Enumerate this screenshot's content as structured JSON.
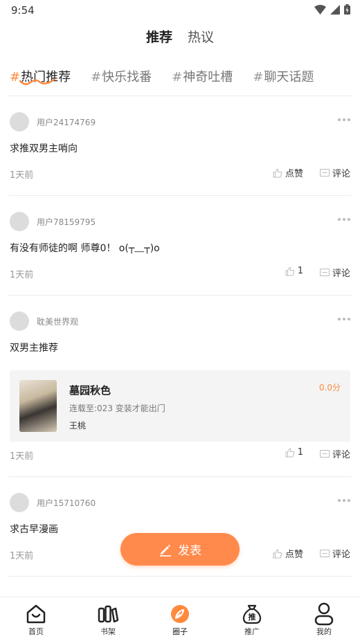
{
  "status_bar": {
    "time": "9:54"
  },
  "top_tabs": [
    {
      "label": "推荐",
      "active": true
    },
    {
      "label": "热议",
      "active": false
    }
  ],
  "topic_tabs": [
    {
      "hash": "#",
      "label": "热门推荐",
      "active": true
    },
    {
      "hash": "#",
      "label": "快乐找番",
      "active": false
    },
    {
      "hash": "#",
      "label": "神奇吐槽",
      "active": false
    },
    {
      "hash": "#",
      "label": "聊天话题",
      "active": false
    }
  ],
  "posts": [
    {
      "username": "用户24174769",
      "text": "求推双男主哨向",
      "time": "1天前",
      "like_label": "点赞",
      "comment_label": "评论"
    },
    {
      "username": "用户78159795",
      "text": "有没有师徒的啊 师尊0！ o(┬﹏┬)o",
      "time": "1天前",
      "like_label": "1",
      "comment_label": "评论"
    },
    {
      "username": "耽美世界观",
      "text": "双男主推荐",
      "time": "1天前",
      "like_label": "1",
      "comment_label": "评论",
      "book": {
        "title": "墓园秋色",
        "score": "0.0分",
        "chapter": "连载至:023 变装才能出门",
        "author": "王桃"
      }
    },
    {
      "username": "用户15710760",
      "text": "求古早漫画",
      "time": "1天前",
      "like_label": "点赞",
      "comment_label": "评论"
    }
  ],
  "fab": {
    "label": "发表",
    "icon": "pen-icon"
  },
  "bottom_nav": [
    {
      "label": "首页",
      "icon": "home-icon"
    },
    {
      "label": "书架",
      "icon": "bookshelf-icon"
    },
    {
      "label": "圈子",
      "icon": "circle-icon",
      "active": true
    },
    {
      "label": "推广",
      "icon": "promote-bag-icon",
      "glyph": "推"
    },
    {
      "label": "我的",
      "icon": "profile-icon"
    }
  ],
  "colors": {
    "accent": "#ff8a3d",
    "fab": "#ff8a4c"
  }
}
